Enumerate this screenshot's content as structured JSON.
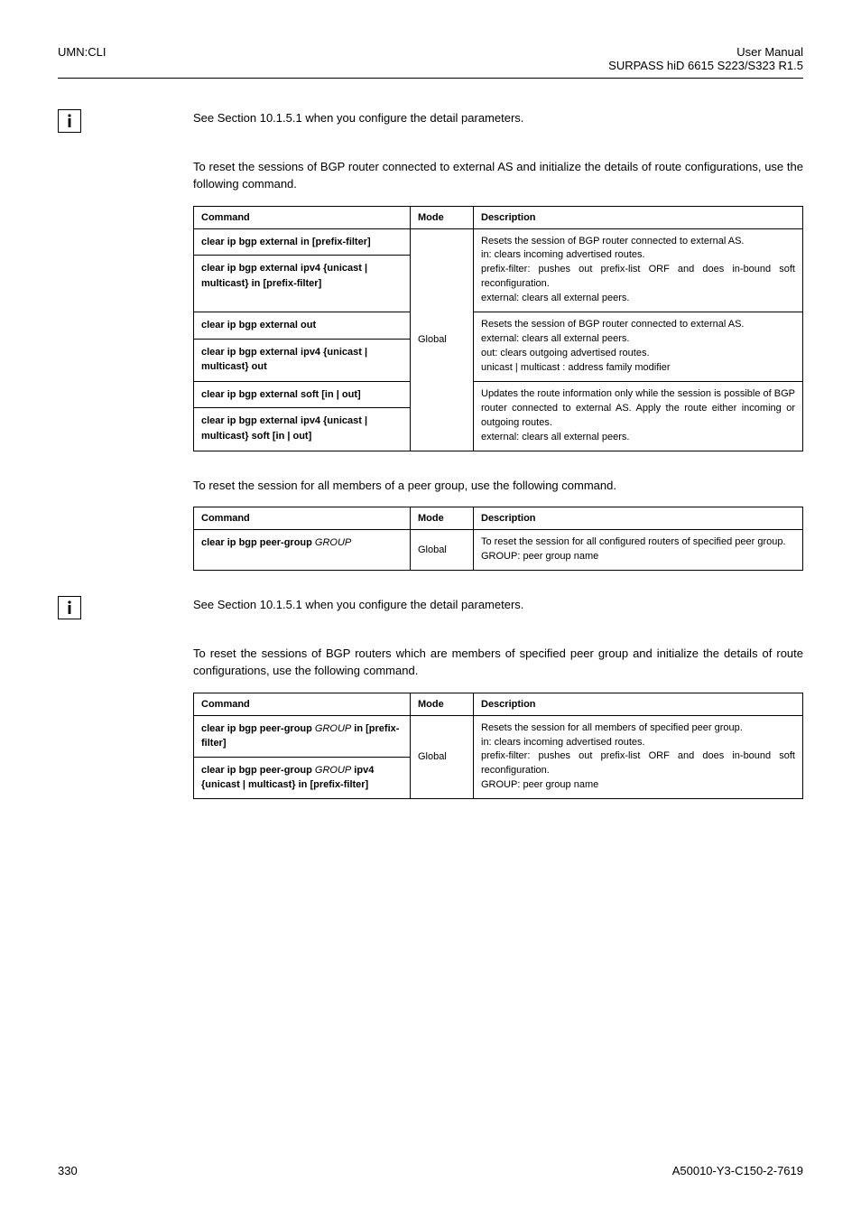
{
  "header": {
    "left": "UMN:CLI",
    "right_line1": "User Manual",
    "right_line2": "SURPASS hiD 6615 S223/S323 R1.5"
  },
  "note_text_1": "See Section 10.1.5.1 when you configure the detail parameters.",
  "para_1": "To reset the sessions of BGP router connected to external AS and initialize the details of route configurations, use the following command.",
  "table1": {
    "h1": "Command",
    "h2": "Mode",
    "h3": "Description",
    "mode": "Global",
    "r1_cmd_a": "clear ip bgp external in [prefix-filter]",
    "r1_cmd_b": "clear ip bgp external ipv4 {unicast | multicast} in [prefix-filter]",
    "r1_desc": "Resets the session of BGP router connected to external AS.\nin: clears incoming advertised routes.\nprefix-filter: pushes out prefix-list ORF and does in-bound soft reconfiguration.\nexternal: clears all external peers.",
    "r2_cmd_a": "clear ip bgp external out",
    "r2_cmd_b": "clear ip bgp external ipv4 {unicast | multicast} out",
    "r2_desc": "Resets the session of BGP router connected to external AS.\nexternal: clears all external peers.\nout: clears outgoing advertised routes.\nunicast | multicast : address family modifier",
    "r3_cmd_a": "clear ip bgp external soft [in | out]",
    "r3_cmd_b": "clear ip bgp external ipv4 {unicast | multicast} soft [in | out]",
    "r3_desc": "Updates the route information only while the session is possible of BGP router connected to external AS. Apply the route either incoming or outgoing routes.\nexternal: clears all external peers."
  },
  "para_2": "To reset the session for all members of a peer group, use the following command.",
  "table2": {
    "h1": "Command",
    "h2": "Mode",
    "h3": "Description",
    "mode": "Global",
    "r1_cmd": "clear ip bgp peer-group GROUP",
    "r1_desc": "To reset the session for all configured routers of specified peer group.\nGROUP: peer group name"
  },
  "note_text_2": "See Section 10.1.5.1 when you configure the detail parameters.",
  "para_3": "To reset the sessions of BGP routers which are members of specified peer group and initialize the details of route configurations, use the following command.",
  "table3": {
    "h1": "Command",
    "h2": "Mode",
    "h3": "Description",
    "mode": "Global",
    "r1_cmd": "clear ip bgp peer-group GROUP in [prefix-filter]",
    "r2_cmd": "clear ip bgp peer-group GROUP ipv4 {unicast | multicast} in [prefix-filter]",
    "desc": "Resets the session for all members of specified peer group.\nin: clears incoming advertised routes.\nprefix-filter: pushes out prefix-list ORF and does in-bound soft reconfiguration.\nGROUP: peer group name"
  },
  "footer": {
    "left": "330",
    "right": "A50010-Y3-C150-2-7619"
  }
}
